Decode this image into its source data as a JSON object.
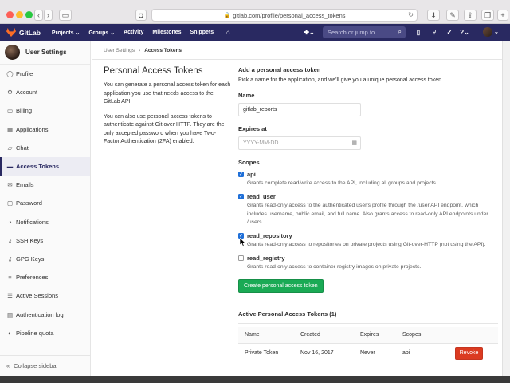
{
  "browser": {
    "url": "gitlab.com/profile/personal_access_tokens"
  },
  "topbar": {
    "brand": "GitLab",
    "nav": [
      "Projects ⌄",
      "Groups ⌄",
      "Activity",
      "Milestones",
      "Snippets"
    ],
    "search_placeholder": "Search or jump to…"
  },
  "sidebar": {
    "title": "User Settings",
    "items": [
      {
        "label": "Profile",
        "icon": "user-icon"
      },
      {
        "label": "Account",
        "icon": "gear-icon"
      },
      {
        "label": "Billing",
        "icon": "card-icon"
      },
      {
        "label": "Applications",
        "icon": "apps-icon"
      },
      {
        "label": "Chat",
        "icon": "chat-icon"
      },
      {
        "label": "Access Tokens",
        "icon": "token-icon",
        "active": true
      },
      {
        "label": "Emails",
        "icon": "envelope-icon"
      },
      {
        "label": "Password",
        "icon": "lock-icon"
      },
      {
        "label": "Notifications",
        "icon": "bell-icon"
      },
      {
        "label": "SSH Keys",
        "icon": "key-icon"
      },
      {
        "label": "GPG Keys",
        "icon": "key-icon"
      },
      {
        "label": "Preferences",
        "icon": "sliders-icon"
      },
      {
        "label": "Active Sessions",
        "icon": "sessions-icon"
      },
      {
        "label": "Authentication log",
        "icon": "log-icon"
      },
      {
        "label": "Pipeline quota",
        "icon": "quota-icon"
      }
    ],
    "collapse_label": "Collapse sidebar"
  },
  "breadcrumb": {
    "parent": "User Settings",
    "current": "Access Tokens"
  },
  "intro": {
    "title": "Personal Access Tokens",
    "p1": "You can generate a personal access token for each application you use that needs access to the GitLab API.",
    "p2": "You can also use personal access tokens to authenticate against Git over HTTP. They are the only accepted password when you have Two-Factor Authentication (2FA) enabled."
  },
  "form": {
    "section_title": "Add a personal access token",
    "section_desc": "Pick a name for the application, and we'll give you a unique personal access token.",
    "name_label": "Name",
    "name_value": "gitlab_reports",
    "expires_label": "Expires at",
    "expires_placeholder": "YYYY-MM-DD",
    "scopes_label": "Scopes",
    "scopes": [
      {
        "name": "api",
        "checked": true,
        "desc": "Grants complete read/write access to the API, including all groups and projects."
      },
      {
        "name": "read_user",
        "checked": true,
        "desc": "Grants read-only access to the authenticated user's profile through the /user API endpoint, which includes username, public email, and full name. Also grants access to read-only API endpoints under /users."
      },
      {
        "name": "read_repository",
        "checked": true,
        "desc": "Grants read-only access to repositories on private projects using Git-over-HTTP (not using the API)."
      },
      {
        "name": "read_registry",
        "checked": false,
        "desc": "Grants read-only access to container registry images on private projects."
      }
    ],
    "create_button": "Create personal access token"
  },
  "active_tokens": {
    "title": "Active Personal Access Tokens (1)",
    "headers": [
      "Name",
      "Created",
      "Expires",
      "Scopes"
    ],
    "rows": [
      {
        "name": "Private Token",
        "created": "Nov 16, 2017",
        "expires": "Never",
        "scopes": "api",
        "action": "Revoke"
      }
    ]
  },
  "colors": {
    "topbar": "#292961",
    "create_button": "#1aaa55",
    "revoke_button": "#db3b21",
    "checkbox": "#1f6fd8"
  }
}
